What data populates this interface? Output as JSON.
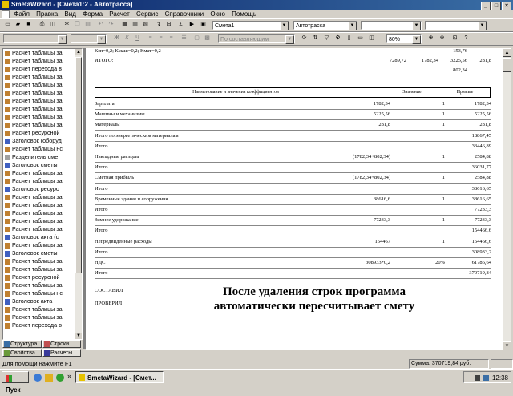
{
  "window": {
    "title": "SmetaWizard - [Смета1:2 - Автотрасса]"
  },
  "menu": [
    "Файл",
    "Правка",
    "Вид",
    "Форма",
    "Расчет",
    "Сервис",
    "Справочники",
    "Окно",
    "Помощь"
  ],
  "toolbar": {
    "document_combo": "Смета1",
    "object_combo": "Автотрасса",
    "style_combo": "По составляющим",
    "zoom": "80%"
  },
  "tree": {
    "items": [
      "Расчет таблицы за",
      "Расчет таблицы за",
      "Расчет перехода в",
      "Расчет таблицы за",
      "Расчет таблицы за",
      "Расчет таблицы за",
      "Расчет таблицы за",
      "Расчет таблицы за",
      "Расчет таблицы за",
      "Расчет таблицы за",
      "Расчет ресурсной",
      "Заголовок (оборуд",
      "Расчет таблицы нс",
      "Разделитель смет",
      "Заголовок сметы",
      "Расчет таблицы за",
      "Расчет таблицы за",
      "Заголовок ресурс",
      "Расчет таблицы за",
      "Расчет таблицы за",
      "Расчет таблицы за",
      "Расчет таблицы за",
      "Расчет таблицы за",
      "Заголовок акта (с",
      "Расчет таблицы за",
      "Заголовок сметы",
      "Расчет таблицы за",
      "Расчет таблицы за",
      "Расчет ресурсной",
      "Расчет таблицы за",
      "Расчет таблицы нс",
      "Заголовок акта",
      "Расчет таблицы за",
      "Расчет таблицы за",
      "Расчет перехода в"
    ],
    "tabs": [
      "Структура",
      "Строки",
      "Свойства",
      "Расчеты"
    ]
  },
  "document": {
    "coef_line": "Кзп=0,2; Кмаш=0,2; Кмат=0,2",
    "coef_value": "153,76",
    "total_label": "ИТОГО:",
    "total_values": [
      "7289,72",
      "1782,34",
      "3225,56",
      "281,8"
    ],
    "total_sub": "802,34",
    "table_headers": [
      "Наименование и значения коэффициентов",
      "Значение",
      "Прямые"
    ],
    "rows": [
      {
        "name": "Зарплата",
        "formula": "1782,34",
        "coef": "1",
        "value": "1782,34"
      },
      {
        "name": "Машины и механизмы",
        "formula": "5225,56",
        "coef": "1",
        "value": "5225,56"
      },
      {
        "name": "Материалы",
        "formula": "281,8",
        "coef": "1",
        "value": "281,8"
      },
      {
        "name": "Итого по энергетическим материалам",
        "formula": "",
        "coef": "",
        "value": "18867,45"
      },
      {
        "name": "Итого",
        "formula": "",
        "coef": "",
        "value": "33446,89"
      },
      {
        "name": "Накладные расходы",
        "formula": "(1782,34+802,34)",
        "coef": "1",
        "value": "2584,88"
      },
      {
        "name": "Итого",
        "formula": "",
        "coef": "",
        "value": "36031,77"
      },
      {
        "name": "Сметная прибыль",
        "formula": "(1782,34+802,34)",
        "coef": "1",
        "value": "2584,88"
      },
      {
        "name": "Итого",
        "formula": "",
        "coef": "",
        "value": "38616,65"
      },
      {
        "name": "Временные здания и сооружения",
        "formula": "38616,6",
        "coef": "1",
        "value": "38616,65"
      },
      {
        "name": "Итого",
        "formula": "",
        "coef": "",
        "value": "77233,3"
      },
      {
        "name": "Зимнее удорожание",
        "formula": "77233,3",
        "coef": "1",
        "value": "77233,3"
      },
      {
        "name": "Итого",
        "formula": "",
        "coef": "",
        "value": "154466,6"
      },
      {
        "name": "Непредвиденные расходы",
        "formula": "154467",
        "coef": "1",
        "value": "154466,6"
      },
      {
        "name": "Итого",
        "formula": "",
        "coef": "",
        "value": "308933,2"
      },
      {
        "name": "НДС",
        "formula": "308933*0,2",
        "coef": "20%",
        "value": "61786,64"
      },
      {
        "name": "Итого",
        "formula": "",
        "coef": "",
        "value": "370719,84"
      }
    ],
    "compiled_label": "СОСТАВИЛ",
    "checked_label": "ПРОВЕРИЛ",
    "note_line1": "После удаления строк программа",
    "note_line2": "автоматически пересчитывает смету"
  },
  "status": {
    "help": "Для помощи нажмите F1",
    "sum": "Сумма: 370719,84 руб."
  },
  "taskbar": {
    "start": "Пуск",
    "task": "SmetaWizard - [Смет...",
    "clock": "12:38"
  }
}
